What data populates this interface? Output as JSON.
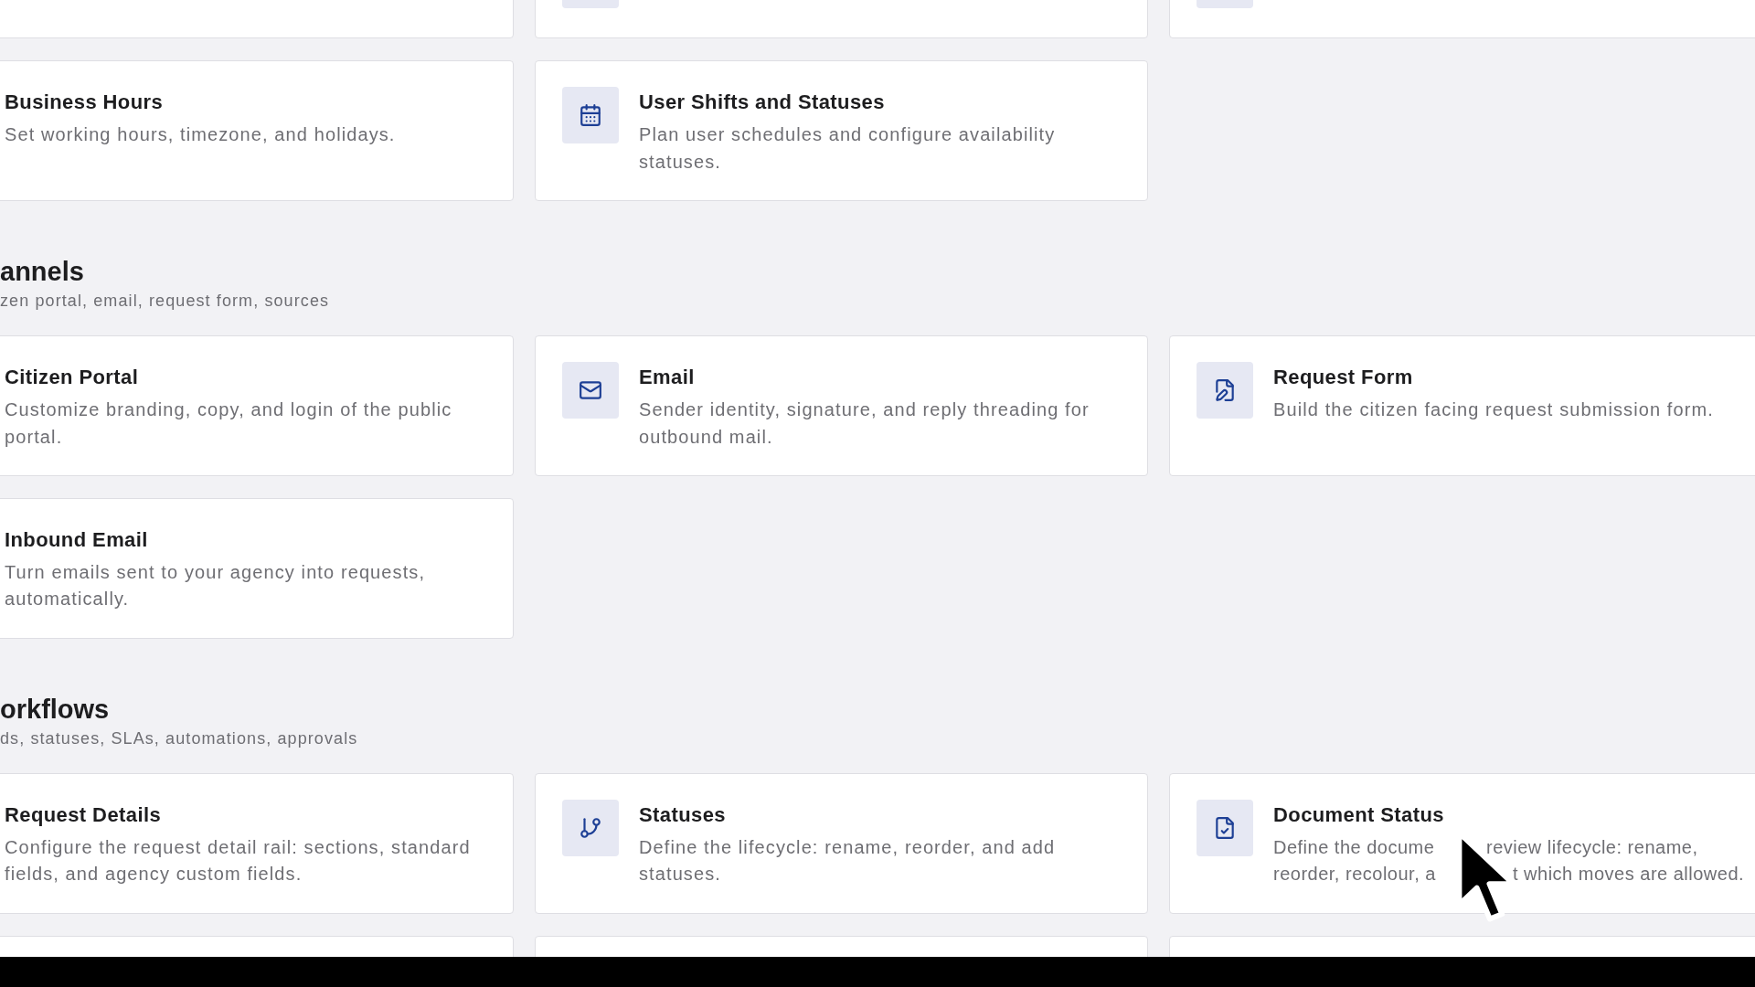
{
  "sections": [
    {
      "cards": [
        {
          "kind": "setting"
        },
        {
          "kind": "setting"
        },
        {
          "kind": "setting"
        },
        {
          "kind": "setting",
          "title": "Business Hours",
          "description": "Set working hours, timezone, and holidays."
        },
        {
          "kind": "setting",
          "title": "User Shifts and Statuses",
          "description": "Plan user schedules and configure availability statuses."
        }
      ]
    },
    {
      "heading": "annels",
      "subtitle": "zen portal, email, request form, sources",
      "cards": [
        {
          "kind": "setting",
          "title": "Citizen Portal",
          "description": "Customize branding, copy, and login of the public portal."
        },
        {
          "kind": "setting",
          "title": "Email",
          "description": "Sender identity, signature, and reply threading for outbound mail."
        },
        {
          "kind": "setting",
          "title": "Request Form",
          "description": "Build the citizen facing request submission form."
        },
        {
          "kind": "setting",
          "title": "Inbound Email",
          "description": "Turn emails sent to your agency into requests, automatically."
        }
      ]
    },
    {
      "heading": "orkflows",
      "subtitle": "ds, statuses, SLAs, automations, approvals",
      "cards": [
        {
          "kind": "setting",
          "title": "Request Details",
          "description": "Configure the request detail rail: sections, standard fields, and agency custom fields."
        },
        {
          "kind": "setting",
          "title": "Statuses",
          "description": "Define the lifecycle: rename, reorder, and add statuses."
        },
        {
          "kind": "setting",
          "title": "Document Status",
          "description_lines": [
            [
              "Define the docume",
              "review lifecycle: rename,"
            ],
            [
              "reorder, recolour, a",
              "t which moves are allowed."
            ]
          ]
        },
        {
          "kind": "blank"
        },
        {
          "kind": "blank"
        },
        {
          "kind": "blank"
        }
      ]
    }
  ]
}
